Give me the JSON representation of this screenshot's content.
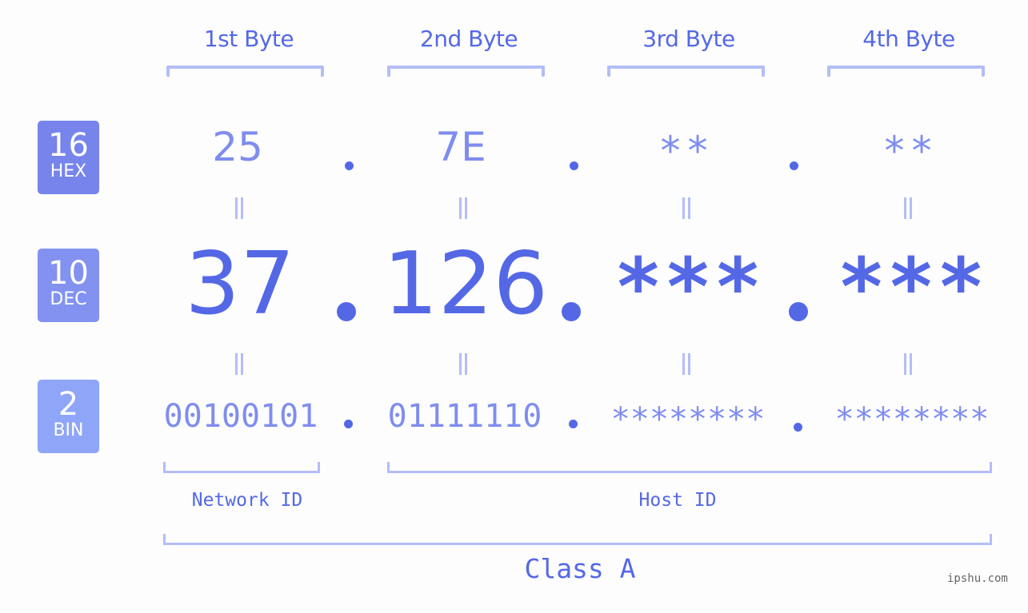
{
  "byte_headers": [
    "1st Byte",
    "2nd Byte",
    "3rd Byte",
    "4th Byte"
  ],
  "badges": {
    "hex": {
      "base": "16",
      "label": "HEX",
      "color": "#7684ec"
    },
    "dec": {
      "base": "10",
      "label": "DEC",
      "color": "#8392f0"
    },
    "bin": {
      "base": "2",
      "label": "BIN",
      "color": "#8ea5f8"
    }
  },
  "hex": [
    "25",
    "7E",
    "**",
    "**"
  ],
  "dec": [
    "37",
    "126",
    "***",
    "***"
  ],
  "bin": [
    "00100101",
    "01111110",
    "********",
    "********"
  ],
  "separator": ".",
  "equals_symbol": "||",
  "network_id_label": "Network ID",
  "host_id_label": "Host ID",
  "class_label": "Class A",
  "watermark": "ipshu.com",
  "colors": {
    "primary": "#5468e6",
    "secondary": "#7f8def",
    "bracket": "#b3bdf8",
    "background": "#fcfdfc"
  }
}
